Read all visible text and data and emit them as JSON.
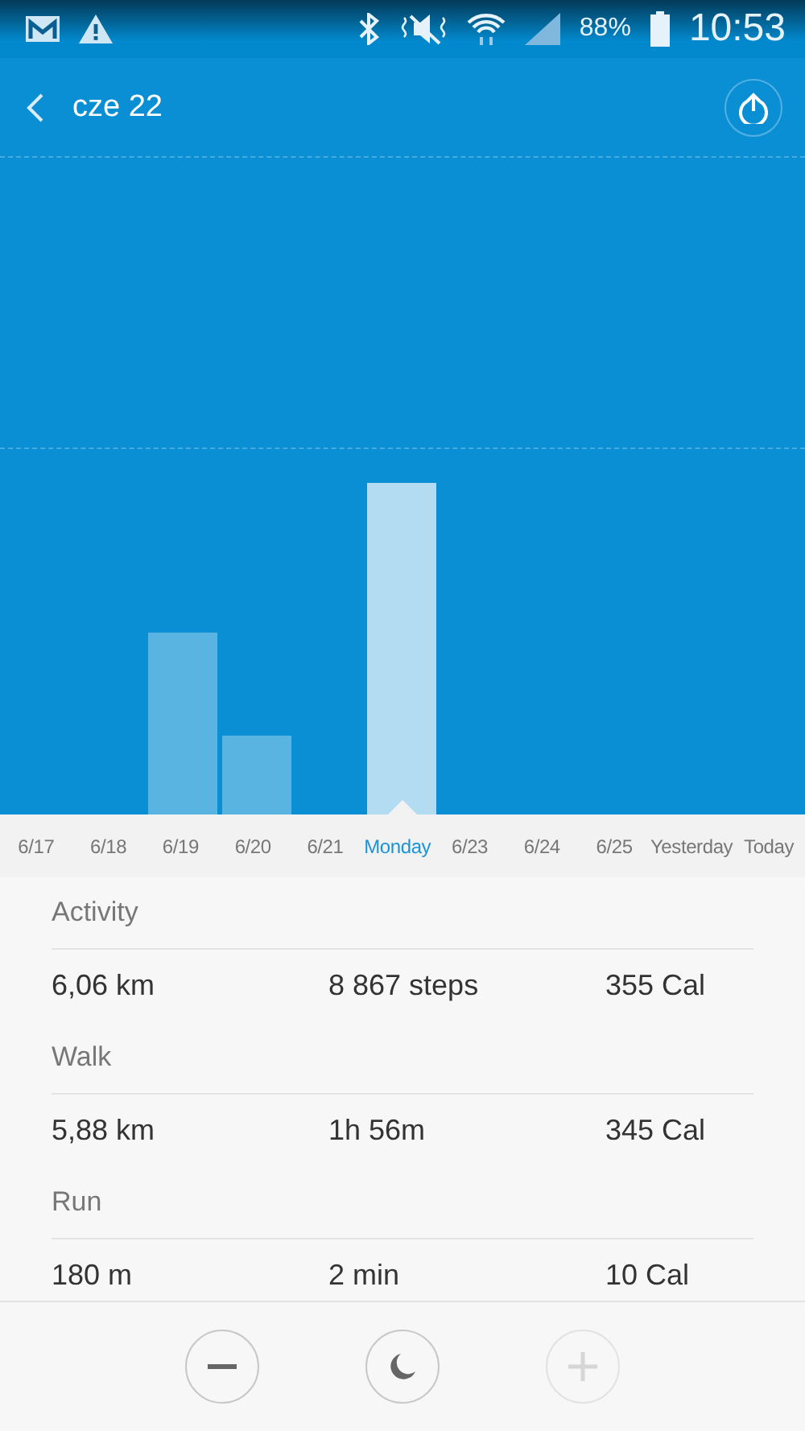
{
  "status_bar": {
    "battery": "88%",
    "time": "10:53"
  },
  "header": {
    "title": "cze 22"
  },
  "days": [
    {
      "label": "6/17",
      "selected": false
    },
    {
      "label": "6/18",
      "selected": false
    },
    {
      "label": "6/19",
      "selected": false
    },
    {
      "label": "6/20",
      "selected": false
    },
    {
      "label": "6/21",
      "selected": false
    },
    {
      "label": "Monday",
      "selected": true
    },
    {
      "label": "6/23",
      "selected": false
    },
    {
      "label": "6/24",
      "selected": false
    },
    {
      "label": "6/25",
      "selected": false
    },
    {
      "label": "Yesterday",
      "selected": false
    },
    {
      "label": "Today",
      "selected": false
    }
  ],
  "sections": [
    {
      "title": "Activity",
      "values": [
        "6,06 km",
        "8 867 steps",
        "355 Cal"
      ]
    },
    {
      "title": "Walk",
      "values": [
        "5,88 km",
        "1h 56m",
        "345 Cal"
      ]
    },
    {
      "title": "Run",
      "values": [
        "180 m",
        "2 min",
        "10 Cal"
      ]
    }
  ],
  "controls": [
    {
      "kind": "minus",
      "disabled": false
    },
    {
      "kind": "moon",
      "disabled": false
    },
    {
      "kind": "plus",
      "disabled": true
    }
  ]
}
